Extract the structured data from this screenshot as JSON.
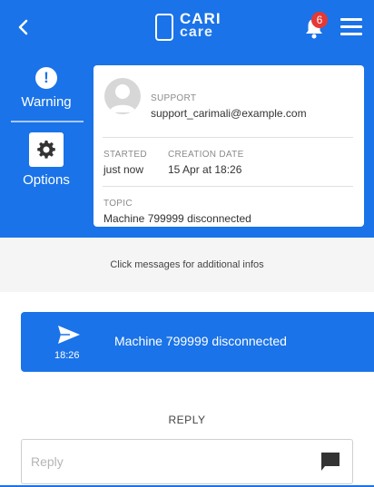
{
  "header": {
    "logo_line1": "CARI",
    "logo_line2": "care",
    "notification_count": "6"
  },
  "sidebar": {
    "items": [
      {
        "label": "Warning",
        "icon": "warning-icon"
      },
      {
        "label": "Options",
        "icon": "gear-icon"
      }
    ]
  },
  "ticket": {
    "support_label": "SUPPORT",
    "support_email": "support_carimali@example.com",
    "started_label": "STARTED",
    "started_value": "just now",
    "creation_label": "CREATION DATE",
    "creation_value": "15 Apr at 18:26",
    "topic_label": "TOPIC",
    "topic_value": "Machine 799999 disconnected"
  },
  "hint": "Click messages for additional infos",
  "messages": [
    {
      "time": "18:26",
      "text": "Machine 799999 disconnected",
      "icon": "send-icon"
    }
  ],
  "reply": {
    "title": "REPLY",
    "placeholder": "Reply"
  },
  "colors": {
    "primary": "#1a73e8",
    "badge": "#e53935",
    "hint_bg": "#f5f5f5"
  }
}
